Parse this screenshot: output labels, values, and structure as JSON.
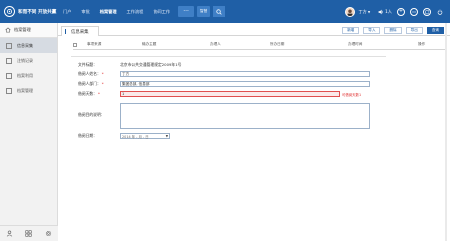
{
  "header": {
    "logo_text": "和而不同 开放共赢",
    "nav": [
      "门户",
      "审批",
      "档案管理",
      "工作流程",
      "协同工作"
    ],
    "nav_active": 2,
    "more_label": "···",
    "extra_label": "智慧",
    "user_name": "丁方",
    "sound_label": "1人",
    "accent": "#1f5fa6"
  },
  "sidebar": {
    "title": "档案管理",
    "items": [
      "信息采集",
      "注销记录",
      "档案利用",
      "档案管理"
    ],
    "active_index": 0,
    "bottom_icons": [
      "user-icon",
      "grid-icon",
      "settings-icon"
    ]
  },
  "main": {
    "tab_label": "信息采集",
    "toolbar": [
      "新增",
      "导入",
      "删除",
      "导出",
      "查询"
    ],
    "columns": [
      "事项来源",
      "输办主题",
      "办理人",
      "所办日期",
      "办理时间",
      "操作"
    ]
  },
  "form": {
    "file_label": "文件标题：",
    "file_value": "北京市公共交通管理规定2009年1号",
    "applicant_label": "借阅人姓名：",
    "applicant_value": "丁方",
    "dept_label": "借阅人部门：",
    "dept_value": "集团总部, 信息部",
    "days_label": "借阅天数：",
    "days_value": "1",
    "days_error": "可借阅天数1",
    "reason_label": "借阅目的说明：",
    "reason_value": "",
    "date_label": "借阅日期：",
    "date_placeholder": "2014 年 - 月 - 日"
  }
}
